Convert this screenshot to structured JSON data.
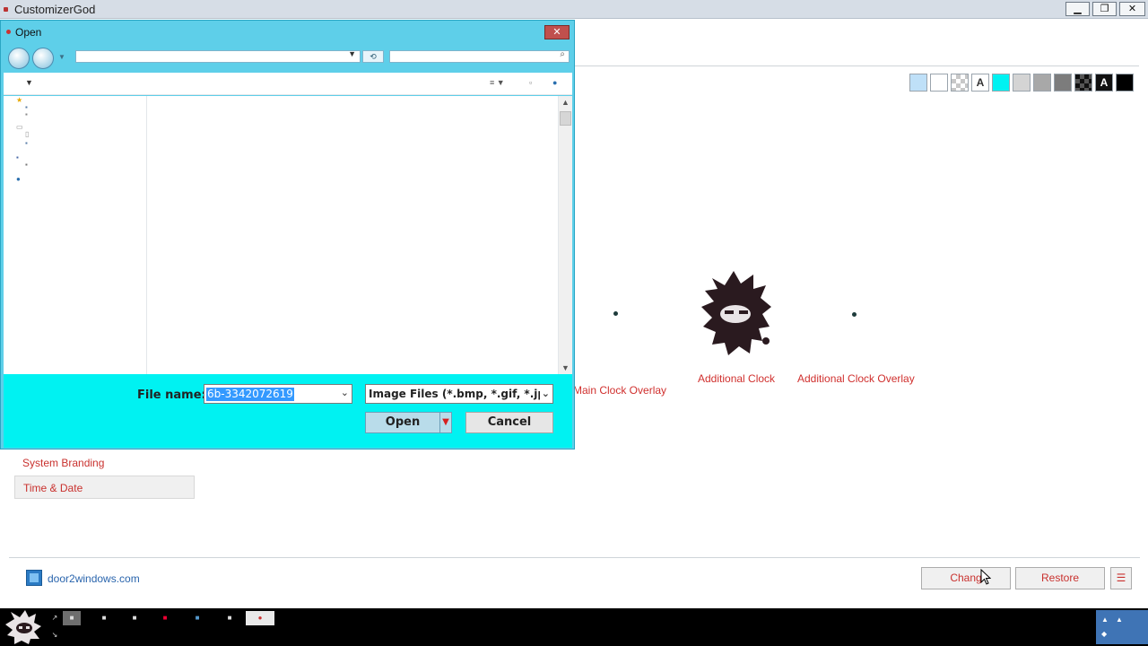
{
  "app": {
    "title": "CustomizerGod",
    "window_buttons": {
      "minimize": "▁",
      "maximize": "❐",
      "close": "✕"
    }
  },
  "swatches": [
    {
      "bg": "#bfe0f8",
      "label": ""
    },
    {
      "bg": "#ffffff",
      "label": ""
    },
    {
      "bg": "checker",
      "label": ""
    },
    {
      "bg": "#ffffff",
      "label": "A"
    },
    {
      "bg": "#00f2f2",
      "label": ""
    },
    {
      "bg": "#d4d4d4",
      "label": ""
    },
    {
      "bg": "#a8a8a8",
      "label": ""
    },
    {
      "bg": "#7c7c7c",
      "label": ""
    },
    {
      "bg": "checker-dark",
      "label": ""
    },
    {
      "bg": "#111111",
      "label": "A"
    },
    {
      "bg": "#000000",
      "label": ""
    }
  ],
  "preview": {
    "main_clock_overlay": "Main Clock Overlay",
    "additional_clock": "Additional Clock",
    "additional_clock_overlay": "Additional Clock Overlay"
  },
  "nav": {
    "system_branding": "System Branding",
    "time_date": "Time & Date"
  },
  "footer": {
    "brand_link": "door2windows.com",
    "change_button": "Chang",
    "restore_button": "Restore",
    "menu_button": "☰"
  },
  "dialog": {
    "title": "Open",
    "close": "✕",
    "file_name_label": "File name:",
    "file_name_value": "6b-3342072619",
    "file_type": "Image Files (*.bmp, *.gif, *.jp",
    "open_button": "Open",
    "open_split": "▼",
    "cancel_button": "Cancel"
  },
  "colors": {
    "accent_red": "#d0302e",
    "dialog_frame": "#5ecfe9",
    "dialog_bottom": "#00f2f2",
    "link_blue": "#2a65ad"
  }
}
